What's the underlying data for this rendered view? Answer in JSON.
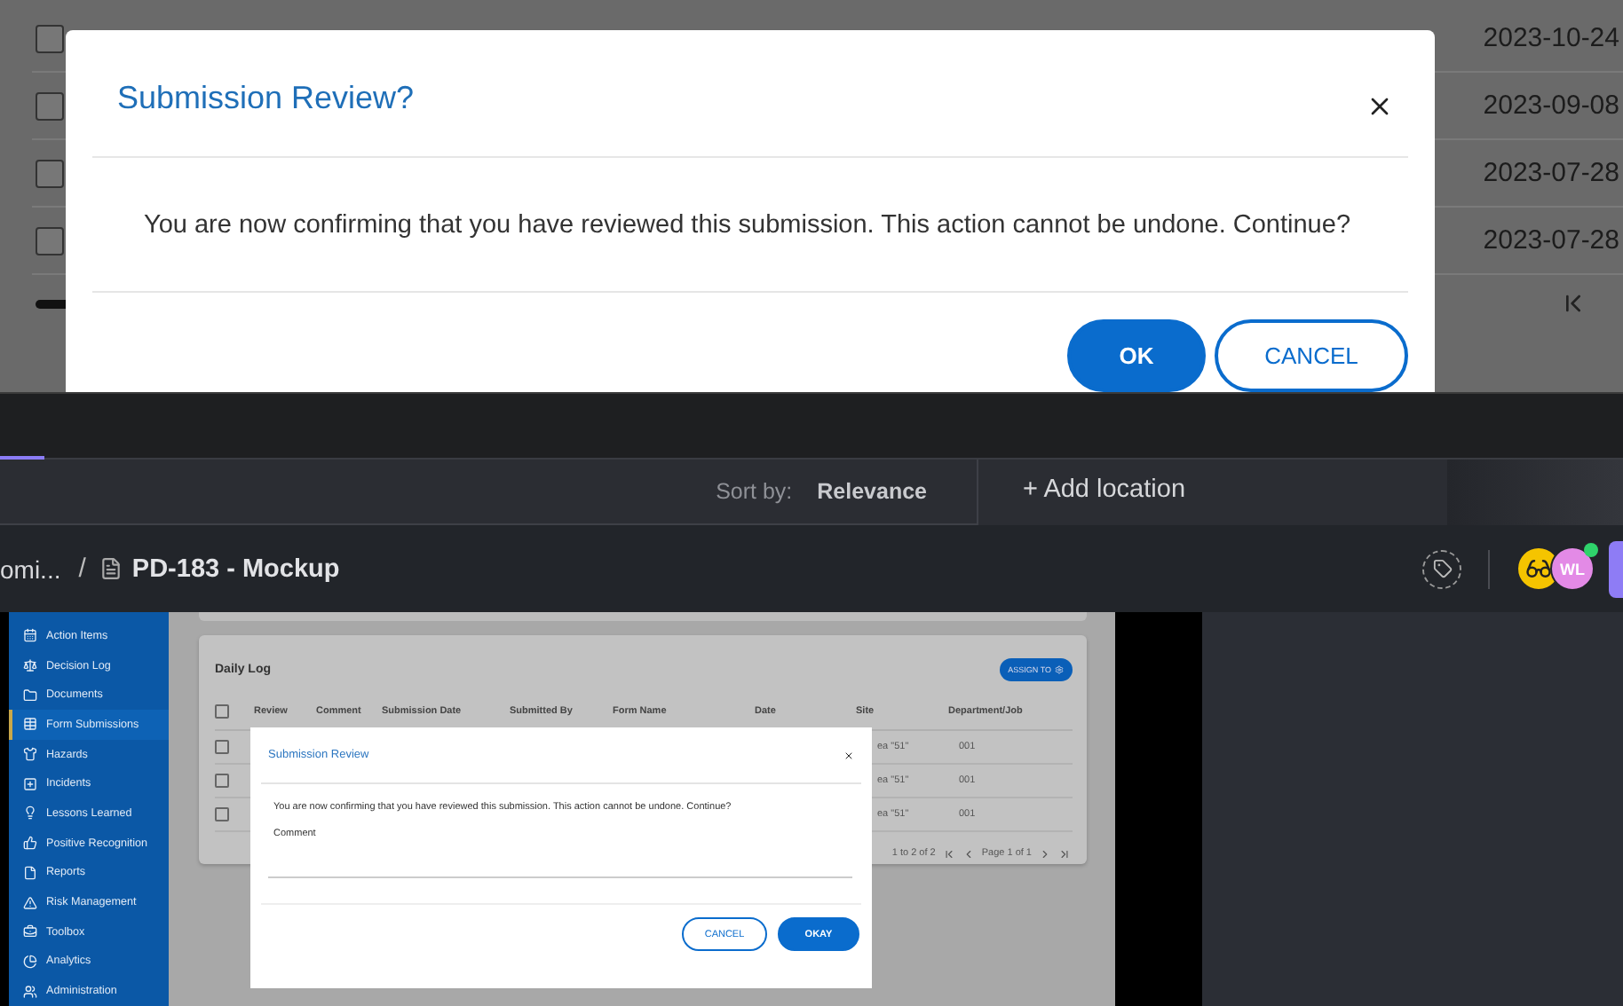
{
  "background_table": {
    "rows": [
      {
        "checked": false,
        "date": "2023-10-24"
      },
      {
        "checked": false,
        "date": "2023-09-08"
      },
      {
        "checked": false,
        "date": "2023-07-28"
      },
      {
        "checked": false,
        "date": "2023-07-28"
      }
    ]
  },
  "confirm_dialog": {
    "title": "Submission Review?",
    "message": "You are now confirming that you have reviewed this submission. This action cannot be undone. Continue?",
    "buttons": [
      {
        "label": "OK",
        "kind": "primary"
      },
      {
        "label": "CANCEL",
        "kind": "secondary"
      }
    ]
  },
  "search_bar": {
    "sort_label": "Sort by:",
    "sort_value": "Relevance",
    "add_location": "+ Add location"
  },
  "breadcrumb": {
    "parent": "omi...",
    "separator": "/",
    "current": "PD-183 - Mockup"
  },
  "avatars": [
    {
      "kind": "icon"
    },
    {
      "kind": "initials",
      "initials": "WL",
      "online": true
    }
  ],
  "mockup": {
    "sidebar": {
      "items": [
        {
          "label": "Action Items",
          "selected": false
        },
        {
          "label": "Decision Log",
          "selected": false
        },
        {
          "label": "Documents",
          "selected": false
        },
        {
          "label": "Form Submissions",
          "selected": true
        },
        {
          "label": "Hazards",
          "selected": false
        },
        {
          "label": "Incidents",
          "selected": false
        },
        {
          "label": "Lessons Learned",
          "selected": false
        },
        {
          "label": "Positive Recognition",
          "selected": false
        },
        {
          "label": "Reports",
          "selected": false
        },
        {
          "label": "Risk Management",
          "selected": false
        },
        {
          "label": "Toolbox",
          "selected": false
        },
        {
          "label": "Analytics",
          "selected": false
        },
        {
          "label": "Administration",
          "selected": false
        }
      ]
    },
    "card": {
      "title": "Daily Log",
      "assign_button": "ASSIGN TO",
      "header_checked": false,
      "columns": [
        "Review",
        "Comment",
        "Submission Date",
        "Submitted By",
        "Form Name",
        "Date",
        "Site",
        "Department/Job"
      ],
      "rows": [
        {
          "checked": false,
          "site": "ea \"51\"",
          "department": "001"
        },
        {
          "checked": false,
          "site": "ea \"51\"",
          "department": "001"
        },
        {
          "checked": false,
          "site": "ea \"51\"",
          "department": "001"
        }
      ],
      "pager": {
        "range": "1 to 2 of 2",
        "page": "Page 1 of 1"
      }
    },
    "dialog": {
      "title": "Submission Review",
      "message": "You are now confirming that you have reviewed this submission. This action cannot be undone. Continue?",
      "comment_label": "Comment",
      "buttons": [
        {
          "label": "CANCEL",
          "kind": "secondary"
        },
        {
          "label": "OKAY",
          "kind": "primary"
        }
      ]
    }
  }
}
